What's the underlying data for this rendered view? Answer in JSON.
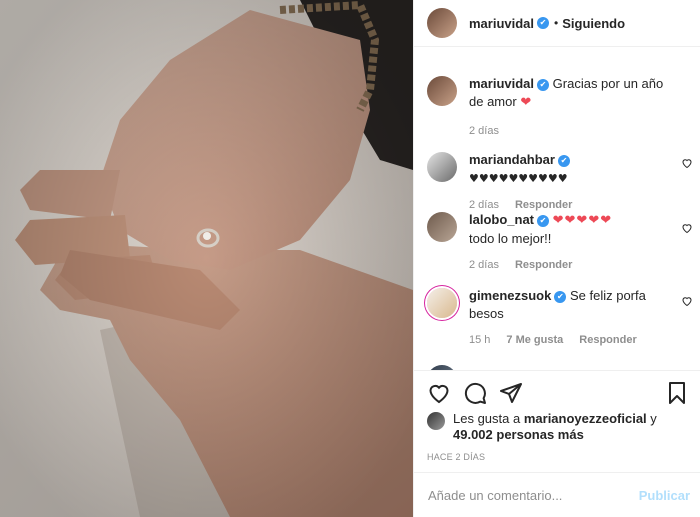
{
  "post": {
    "author": "mariuvidal",
    "follow_status": "Siguiendo",
    "separator": "•"
  },
  "caption": {
    "username": "mariuvidal",
    "text": "Gracias por un año de amor",
    "heart": "❤",
    "time": "2 días"
  },
  "comments": [
    {
      "username": "mariandahbar",
      "text": "♥♥♥♥♥♥♥♥♥♥",
      "time": "2 días",
      "reply": "Responder"
    },
    {
      "username": "lalobo_nat",
      "hearts": "❤❤❤❤❤",
      "text": "todo lo mejor!!",
      "time": "2 días",
      "reply": "Responder"
    },
    {
      "username": "gimenezsuok",
      "text": "Se feliz porfa besos",
      "time": "15 h",
      "likes": "7 Me gusta",
      "reply": "Responder"
    }
  ],
  "likes": {
    "prefix": "Les gusta a",
    "user": "marianoyezzeoficial",
    "conj": "y",
    "count": "49.002 personas más"
  },
  "date": "HACE 2 DÍAS",
  "comment_input": {
    "placeholder": "Añade un comentario...",
    "post_label": "Publicar"
  },
  "icons": [
    "heart-icon",
    "comment-icon",
    "share-icon",
    "bookmark-icon"
  ],
  "colors": {
    "verified": "#3897f0",
    "red": "#ed4956",
    "muted": "#8e8e8e",
    "post_disabled": "#b2dffc"
  }
}
